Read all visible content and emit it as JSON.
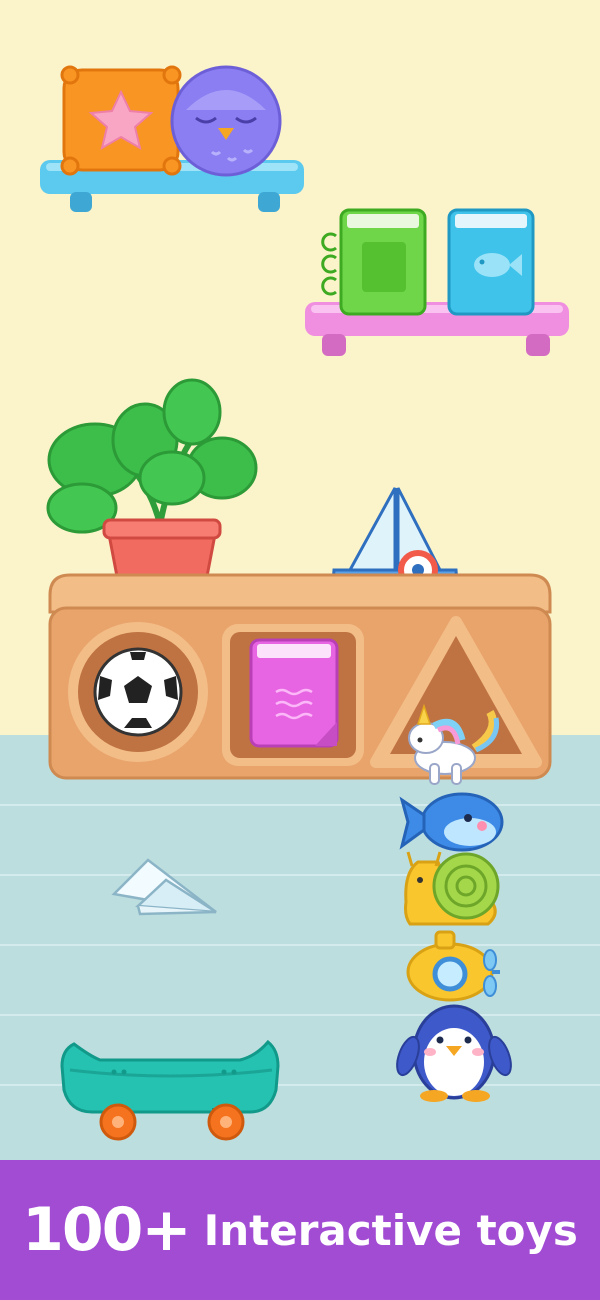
{
  "colors": {
    "wall": "#fbf3c9",
    "floor": "#bcdedf",
    "floor_line": "#d3ebec",
    "banner": "#a24bd3",
    "cabinet": "#e9a46b",
    "cabinet_dark": "#bf7342"
  },
  "banner": {
    "count": "100+",
    "label": "Interactive toys"
  },
  "toys": [
    "pillow-with-star",
    "owl-plush",
    "green-book",
    "blue-fish-book",
    "potted-plant",
    "toy-sailboat",
    "soccer-ball",
    "pink-book",
    "unicorn-toy",
    "blue-whale-toy",
    "snail-toy",
    "yellow-submarine-toy",
    "penguin-toy",
    "paper-plane",
    "skateboard"
  ]
}
